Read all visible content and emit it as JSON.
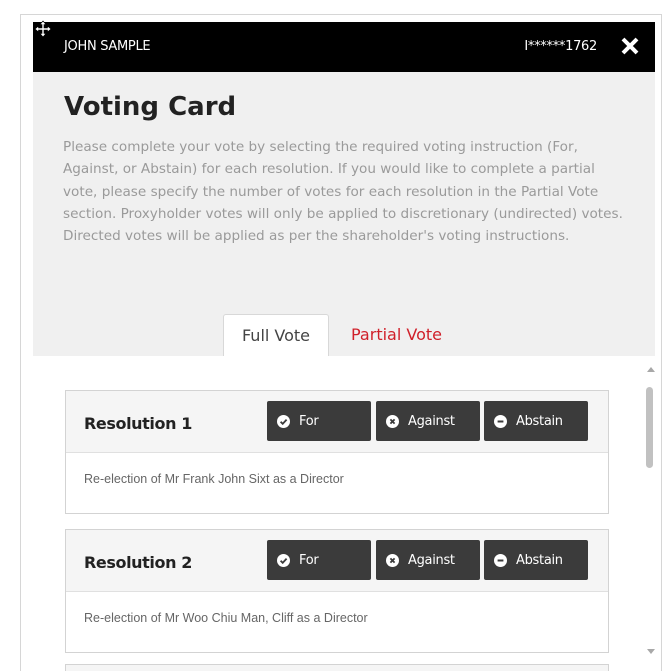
{
  "header": {
    "user_name": "JOHN SAMPLE",
    "account_number": "I******1762",
    "move_icon": "move-arrows-icon",
    "close_icon": "close-x-icon"
  },
  "card": {
    "title": "Voting Card",
    "instructions": "Please complete your vote by selecting the required voting instruction (For, Against, or Abstain) for each resolution. If you would like to complete a partial vote, please specify the number of votes for each resolution in the Partial Vote section. Proxyholder votes will only be applied to discretionary (undirected) votes. Directed votes will be applied as per the shareholder's voting instructions."
  },
  "tabs": [
    {
      "label": "Full Vote",
      "active": true
    },
    {
      "label": "Partial Vote",
      "active": false
    }
  ],
  "vote_options": {
    "for": {
      "label": "For",
      "icon": "check-circle-icon"
    },
    "against": {
      "label": "Against",
      "icon": "x-circle-icon"
    },
    "abstain": {
      "label": "Abstain",
      "icon": "minus-circle-icon"
    }
  },
  "resolutions": [
    {
      "title": "Resolution 1",
      "description": "Re-election of Mr Frank John Sixt as a Director"
    },
    {
      "title": "Resolution 2",
      "description": "Re-election of Mr Woo Chiu Man, Cliff as a Director"
    }
  ],
  "colors": {
    "title_bar": "#000000",
    "header_panel": "#f0f0f0",
    "accent_red": "#d0202a",
    "vote_button": "#3b3b3b"
  }
}
